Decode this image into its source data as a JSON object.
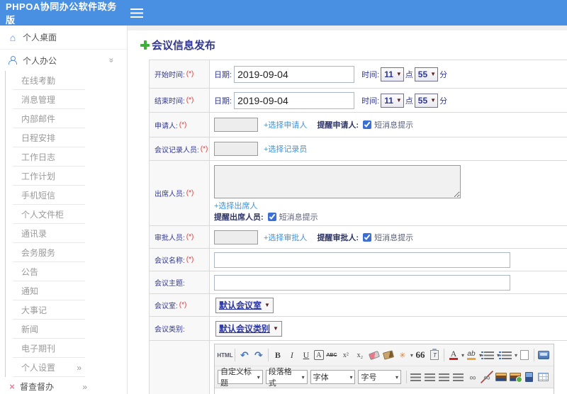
{
  "topbar": {
    "brand": "PHPOA协同办公软件政务版"
  },
  "sidebar": {
    "desktop_label": "个人桌面",
    "office_label": "个人办公",
    "submenu": [
      "在线考勤",
      "消息管理",
      "内部邮件",
      "日程安排",
      "工作日志",
      "工作计划",
      "手机短信",
      "个人文件柜",
      "通讯录",
      "会务服务",
      "公告",
      "通知",
      "大事记",
      "新闻",
      "电子期刊",
      "个人设置"
    ],
    "supervision_label": "督查督办",
    "chevron_right": "»",
    "chevron_down": "»",
    "home_glyph": "⌂",
    "cross_glyph": "×"
  },
  "page": {
    "title": "会议信息发布"
  },
  "form": {
    "req": "(*)",
    "start": {
      "label": "开始时间:",
      "date_label": "日期:",
      "date": "2019-09-04",
      "time_label": "时间:",
      "hour": "11",
      "hour_unit": "点",
      "minute": "55",
      "minute_unit": "分"
    },
    "end": {
      "label": "结束时间:",
      "date_label": "日期:",
      "date": "2019-09-04",
      "time_label": "时间:",
      "hour": "11",
      "hour_unit": "点",
      "minute": "55",
      "minute_unit": "分"
    },
    "applicant": {
      "label": "申请人:",
      "link": "+选择申请人",
      "remind": "提醒申请人:",
      "sms": "短消息提示"
    },
    "recorder": {
      "label": "会议记录人员:",
      "link": "+选择记录员"
    },
    "attendee": {
      "label": "出席人员:",
      "link": "+选择出席人",
      "remind": "提醒出席人员:",
      "sms": "短消息提示"
    },
    "approver": {
      "label": "审批人员:",
      "link": "+选择审批人",
      "remind": "提醒审批人:",
      "sms": "短消息提示"
    },
    "name": {
      "label": "会议名称:"
    },
    "subject": {
      "label": "会议主题:"
    },
    "room": {
      "label": "会议室:",
      "value": "默认会议室",
      "arrow": "▼"
    },
    "category": {
      "label": "会议类别:",
      "value": "默认会议类别",
      "arrow": "▼"
    }
  },
  "editor": {
    "html": "HTML",
    "undo": "↶",
    "redo": "↷",
    "bold": "B",
    "italic": "I",
    "underline": "U",
    "box_a": "A",
    "strike": "ABC",
    "sup": "x²",
    "sub": "x₂",
    "wand": "✳",
    "quote": "66",
    "font_color": "A",
    "highlight": "ab",
    "link": "∞",
    "unlink": "∞",
    "arrow": "▾",
    "selects": {
      "title": "自定义标题",
      "para": "段落格式",
      "font": "字体",
      "size": "字号"
    }
  },
  "colors": {
    "accent": "#4a90e2",
    "link": "#4193d9",
    "label_navy": "#33398e",
    "required_red": "#e33c3c",
    "supervision_pink": "#e87a9a"
  }
}
